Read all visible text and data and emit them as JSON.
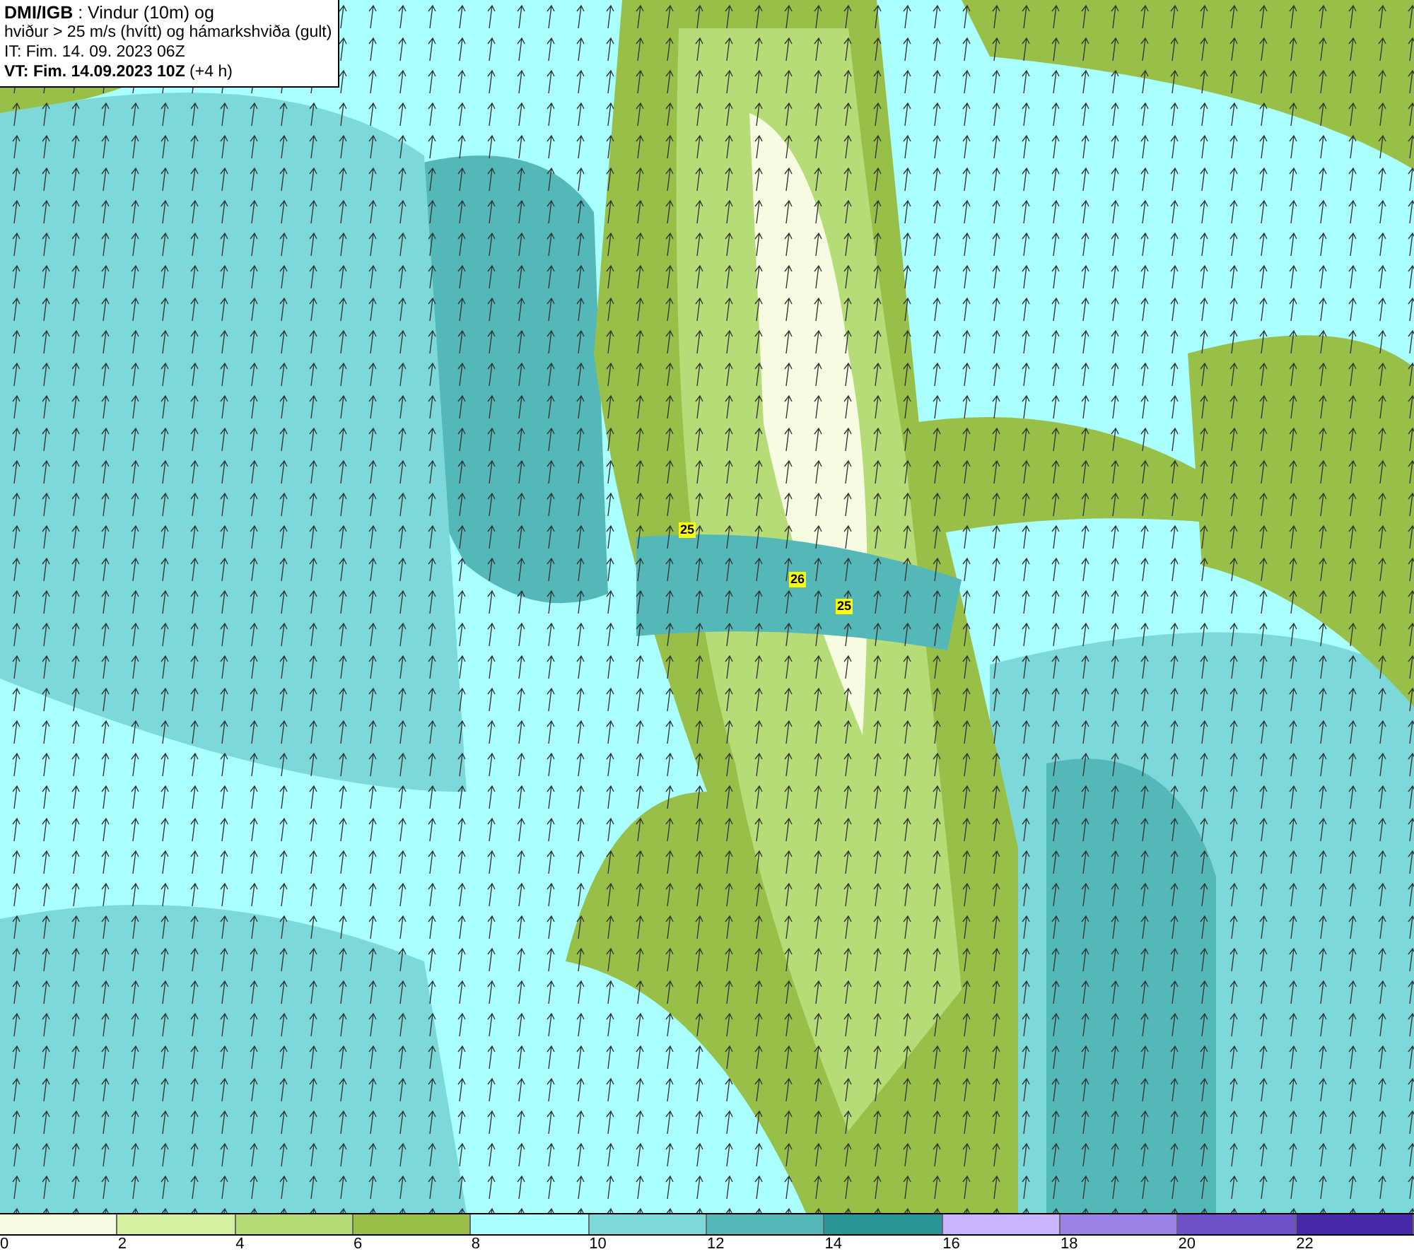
{
  "info_box": {
    "lines": [
      "**DMI/IGB** : Vindur (10m) og",
      "hviður > 25 m/s (hvítt) og hámarkshviða (gult)",
      "IT: Fim. 14. 09. 2023 06Z",
      "**VT: Fim. 14.09.2023 10Z** (+4 h)"
    ]
  },
  "map": {
    "gust_labels": [
      "25",
      "26",
      "25"
    ]
  },
  "legend": {
    "segments": [
      {
        "label": "0",
        "color": "#f7fbe1"
      },
      {
        "label": "2",
        "color": "#d4f0a0"
      },
      {
        "label": "4",
        "color": "#b6dc78"
      },
      {
        "label": "6",
        "color": "#98c048"
      },
      {
        "label": "8",
        "color": "#aaffff"
      },
      {
        "label": "10",
        "color": "#7dd9d9"
      },
      {
        "label": "12",
        "color": "#55b8b8"
      },
      {
        "label": "14",
        "color": "#289696"
      },
      {
        "label": "16",
        "color": "#c8b4ff"
      },
      {
        "label": "18",
        "color": "#9b82e6"
      },
      {
        "label": "20",
        "color": "#6e50c8"
      },
      {
        "label": "22",
        "color": "#4628a8"
      }
    ]
  }
}
